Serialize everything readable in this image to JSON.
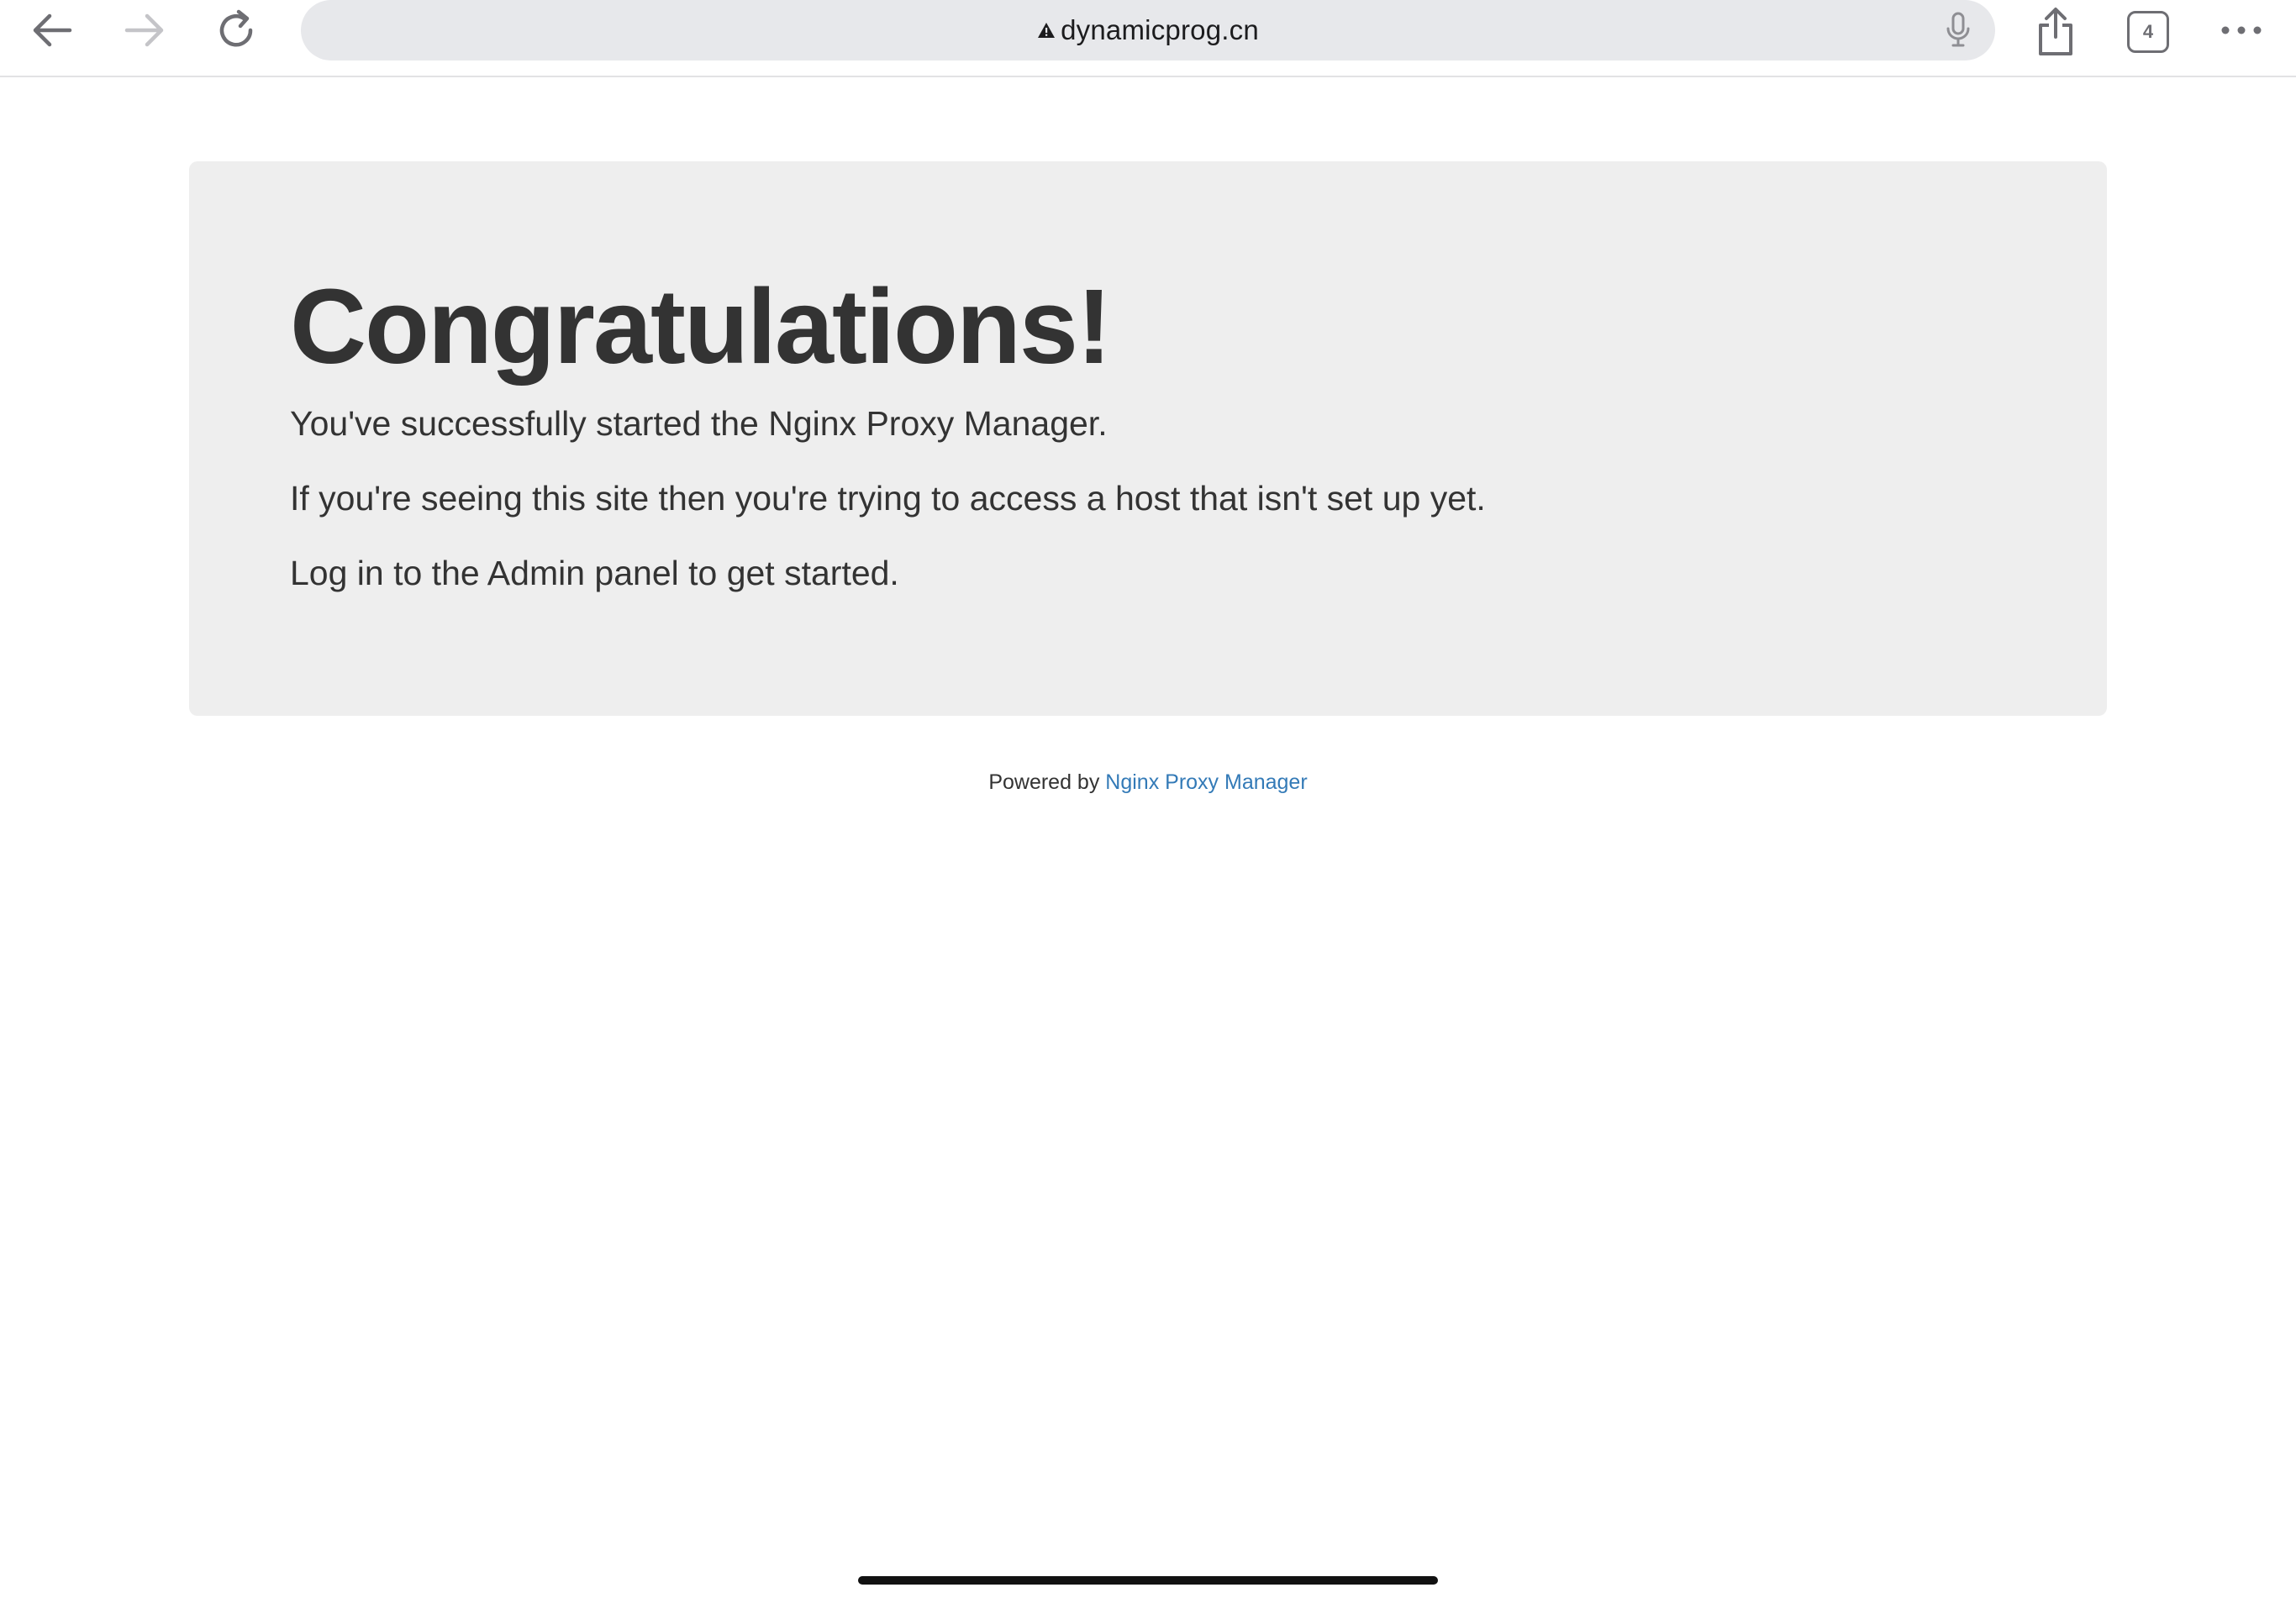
{
  "browser": {
    "url": "dynamicprog.cn",
    "tab_count": "4",
    "icons": {
      "back": "back-arrow-icon",
      "forward": "forward-arrow-icon",
      "reload": "reload-icon",
      "security": "warning-triangle-icon",
      "mic": "microphone-icon",
      "share": "share-icon",
      "tabs": "tabs-icon",
      "more": "more-icon"
    }
  },
  "page": {
    "heading": "Congratulations!",
    "lines": [
      "You've successfully started the Nginx Proxy Manager.",
      "If you're seeing this site then you're trying to access a host that isn't set up yet.",
      "Log in to the Admin panel to get started."
    ],
    "footer": {
      "prefix": "Powered by ",
      "link_text": "Nginx Proxy Manager"
    }
  },
  "colors": {
    "panel_background": "#eeeeee",
    "text": "#333333",
    "link": "#337ab7",
    "address_bar": "#e7e8eb"
  }
}
